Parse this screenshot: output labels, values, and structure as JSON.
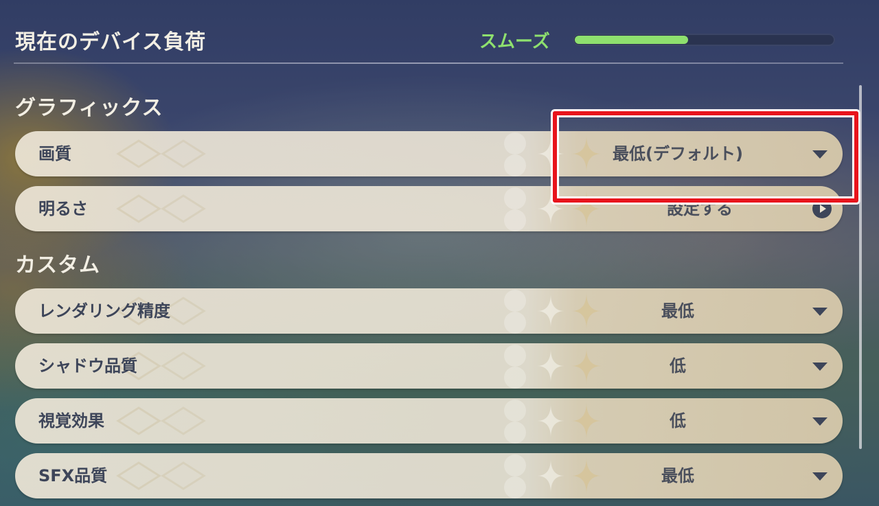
{
  "header": {
    "title": "現在のデバイス負荷",
    "load_status": "スムーズ",
    "load_level": 0.44,
    "accent_color": "#8ee06e"
  },
  "sections": [
    {
      "heading": "グラフィックス",
      "rows": [
        {
          "label": "画質",
          "value": "最低(デフォルト)",
          "control": "dropdown",
          "icon": "chevron-down-icon",
          "highlighted": true
        },
        {
          "label": "明るさ",
          "value": "設定する",
          "control": "action",
          "icon": "arrow-right-circle-icon"
        }
      ]
    },
    {
      "heading": "カスタム",
      "rows": [
        {
          "label": "レンダリング精度",
          "value": "最低",
          "control": "dropdown",
          "icon": "chevron-down-icon"
        },
        {
          "label": "シャドウ品質",
          "value": "低",
          "control": "dropdown",
          "icon": "chevron-down-icon"
        },
        {
          "label": "視覚効果",
          "value": "低",
          "control": "dropdown",
          "icon": "chevron-down-icon"
        },
        {
          "label": "SFX品質",
          "value": "最低",
          "control": "dropdown",
          "icon": "chevron-down-icon"
        }
      ]
    }
  ],
  "highlight_color": "#e8141c"
}
